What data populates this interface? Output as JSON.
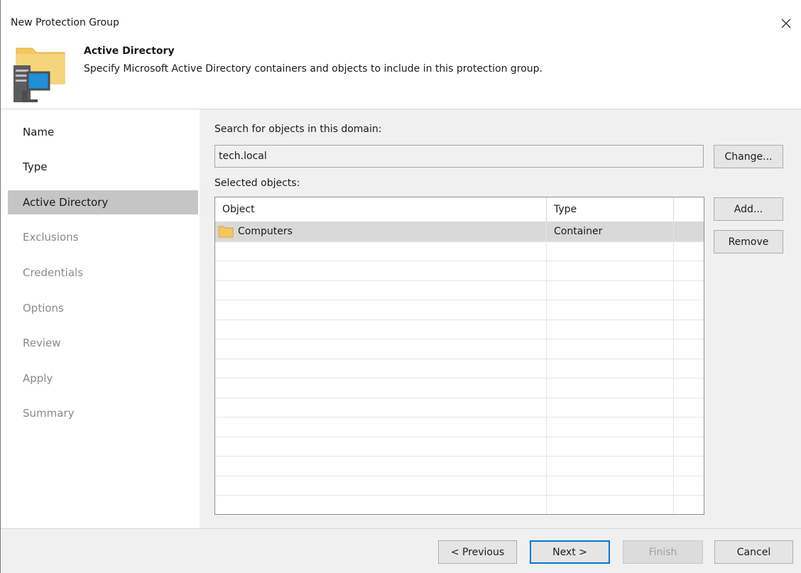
{
  "window": {
    "title": "New Protection Group",
    "close_icon": "close-icon"
  },
  "header": {
    "icon": "active-directory-icon",
    "title": "Active Directory",
    "subtitle": "Specify Microsoft Active Directory containers and objects to include in this protection group."
  },
  "sidebar": {
    "items": [
      {
        "label": "Name",
        "state": "done"
      },
      {
        "label": "Type",
        "state": "done"
      },
      {
        "label": "Active Directory",
        "state": "active"
      },
      {
        "label": "Exclusions",
        "state": "pending"
      },
      {
        "label": "Credentials",
        "state": "pending"
      },
      {
        "label": "Options",
        "state": "pending"
      },
      {
        "label": "Review",
        "state": "pending"
      },
      {
        "label": "Apply",
        "state": "pending"
      },
      {
        "label": "Summary",
        "state": "pending"
      }
    ]
  },
  "main": {
    "domain_label": "Search for objects in this domain:",
    "domain_value": "tech.local",
    "change_button": "Change...",
    "selected_label": "Selected objects:",
    "add_button": "Add...",
    "remove_button": "Remove",
    "table": {
      "columns": [
        "Object",
        "Type"
      ],
      "rows": [
        {
          "object": "Computers",
          "type": "Container",
          "icon": "folder-icon",
          "selected": true
        }
      ]
    }
  },
  "footer": {
    "previous_button": "< Previous",
    "next_button": "Next >",
    "finish_button": "Finish",
    "cancel_button": "Cancel"
  },
  "colors": {
    "active_nav_bg": "#c5c5c5",
    "panel_bg": "#f0f0f0",
    "selected_row_bg": "#d9d9d9",
    "primary_button_border": "#0078d7",
    "folder_yellow": "#f4c75c"
  }
}
